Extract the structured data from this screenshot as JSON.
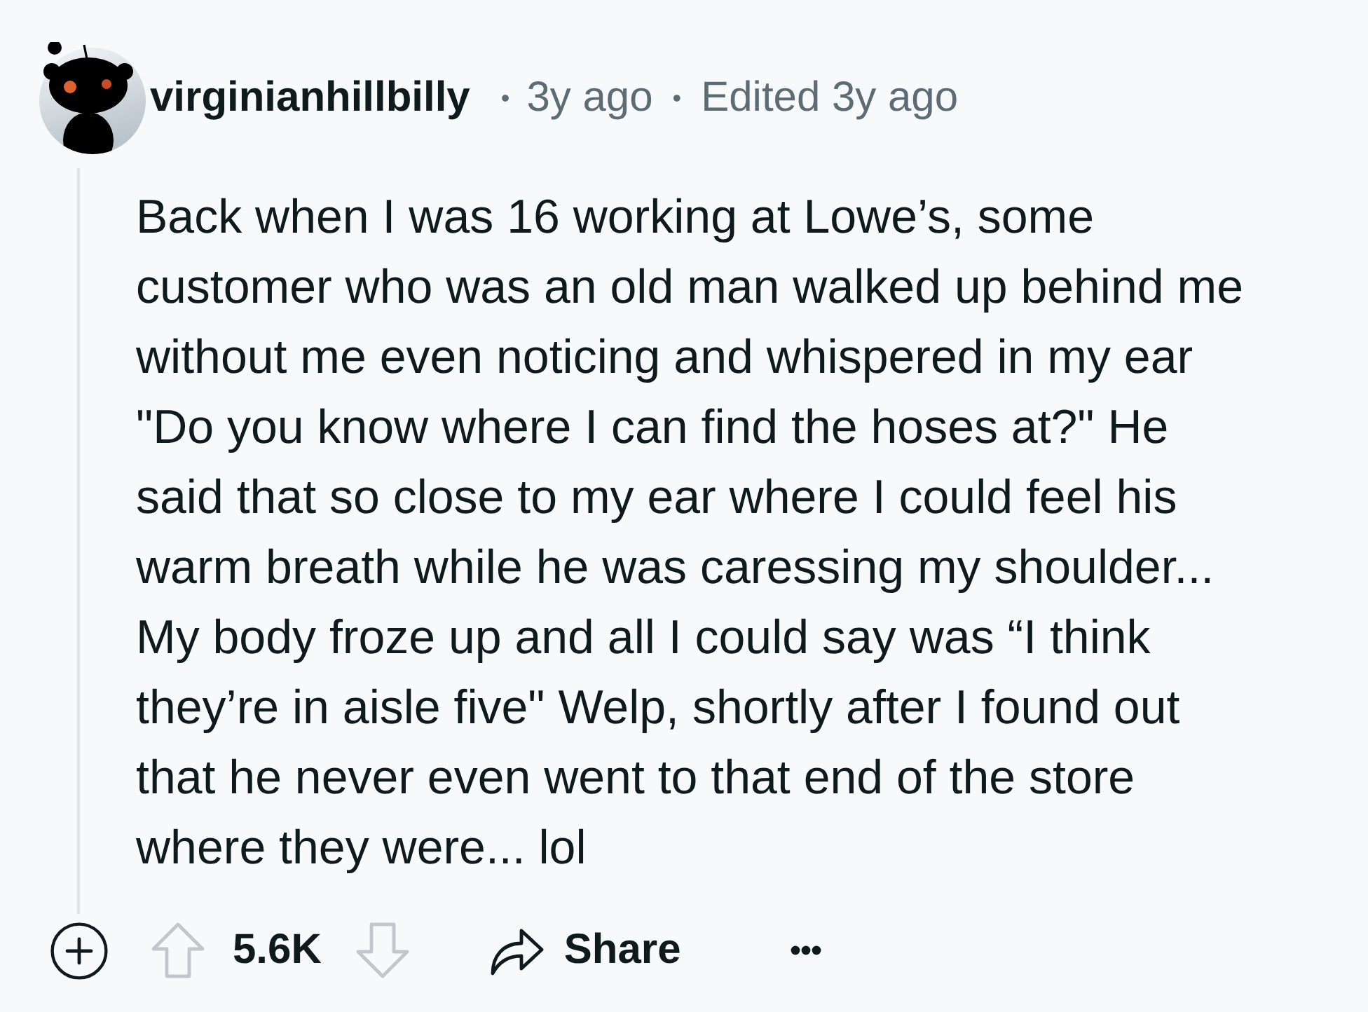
{
  "comment": {
    "author": "virginianhillbilly",
    "separator_1": "•",
    "time": "3y ago",
    "separator_2": "•",
    "edited": "Edited 3y ago",
    "body": "Back when I was 16 working at Lowe’s, some\ncustomer who was an old man walked up behind me\nwithout me even noticing and whispered in my ear\n\"Do you know where I can find the hoses at?\" He\nsaid that so close to my ear where I could feel his\nwarm breath while he was caressing my shoulder...\nMy body froze up and all I could say was “I think\nthey’re in aisle five\" Welp, shortly after I found out\nthat he never even went to that end of the store\nwhere they were... lol",
    "actions": {
      "vote_count": "5.6K",
      "share_label": "Share"
    }
  }
}
